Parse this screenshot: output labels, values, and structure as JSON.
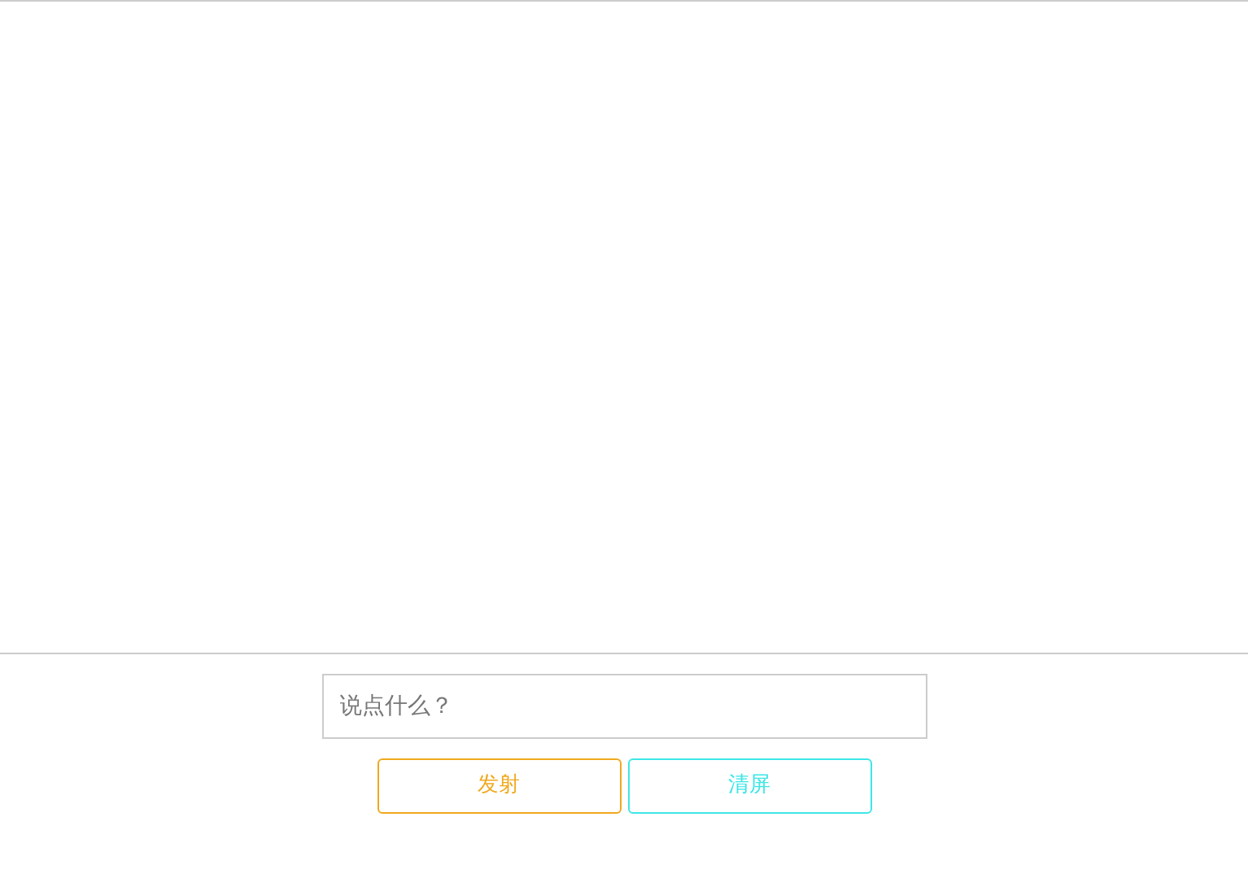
{
  "input": {
    "placeholder": "说点什么？"
  },
  "buttons": [
    {
      "label": "发射",
      "color": "#f0a81e"
    },
    {
      "label": "清屏",
      "color": "#3ee6e6"
    }
  ]
}
